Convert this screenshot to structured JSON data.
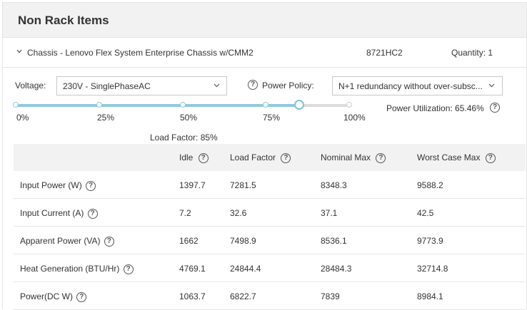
{
  "header": {
    "title": "Non Rack Items"
  },
  "chassis": {
    "name": "Chassis - Lenovo Flex System Enterprise Chassis w/CMM2",
    "model": "8721HC2",
    "quantity": "Quantity: 1"
  },
  "voltage": {
    "label": "Voltage:",
    "selected": "230V - SinglePhaseAC"
  },
  "power_policy": {
    "label": "Power Policy:",
    "selected": "N+1 redundancy without over-subsc..."
  },
  "slider": {
    "value_percent": 85,
    "ticks": [
      "0%",
      "25%",
      "50%",
      "75%",
      "100%"
    ],
    "load_factor_label": "Load Factor: 85%"
  },
  "utilization": {
    "label": "Power Utilization: 65.46%"
  },
  "table": {
    "columns": [
      "",
      "Idle",
      "Load Factor",
      "Nominal Max",
      "Worst Case Max"
    ],
    "rows": [
      {
        "label": "Input Power (W)",
        "values": [
          "1397.7",
          "7281.5",
          "8348.3",
          "9588.2"
        ]
      },
      {
        "label": "Input Current (A)",
        "values": [
          "7.2",
          "32.6",
          "37.1",
          "42.5"
        ]
      },
      {
        "label": "Apparent Power (VA)",
        "values": [
          "1662",
          "7498.9",
          "8536.1",
          "9773.9"
        ]
      },
      {
        "label": "Heat Generation (BTU/Hr)",
        "values": [
          "4769.1",
          "24844.4",
          "28484.3",
          "32714.8"
        ]
      },
      {
        "label": "Power(DC W)",
        "values": [
          "1063.7",
          "6822.7",
          "7839",
          "8984.1"
        ]
      }
    ]
  },
  "icons": {
    "help": "?",
    "expand": "chevron-down-icon",
    "dropdown": "chevron-down-icon"
  },
  "colors": {
    "accent": "#8ec9dd",
    "header_bg": "#f2f2f2"
  }
}
